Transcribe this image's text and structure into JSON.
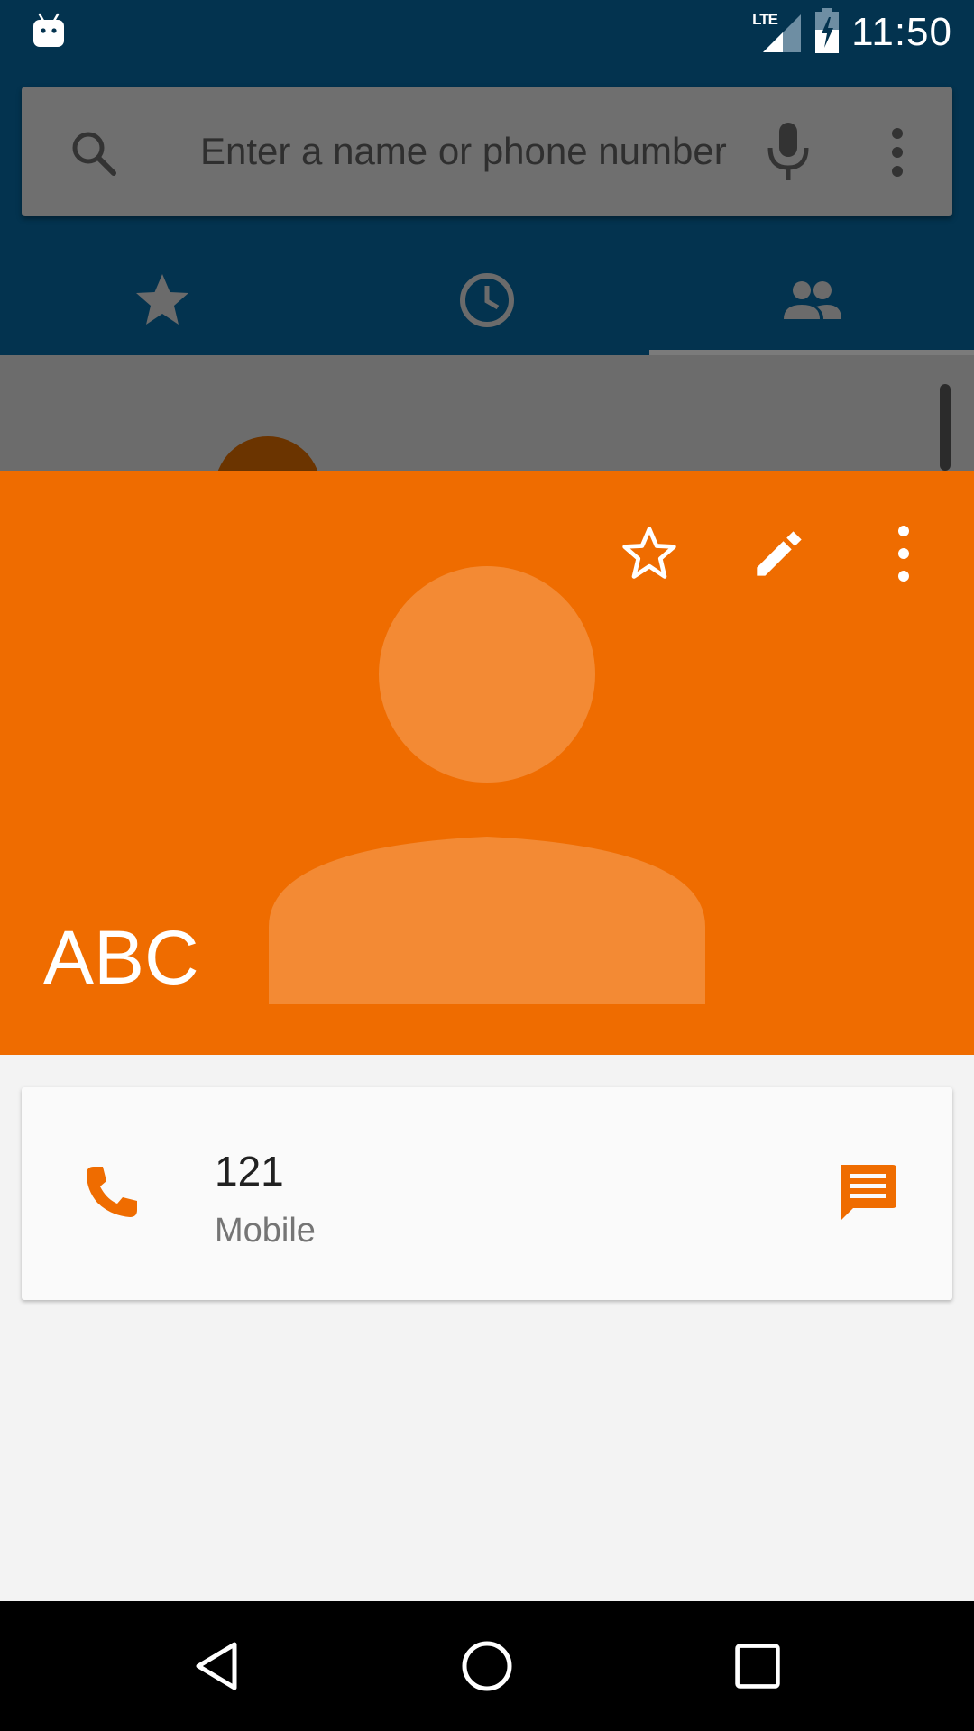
{
  "status_bar": {
    "time": "11:50",
    "network_label": "LTE",
    "icons": [
      "android-notification-icon",
      "lte-signal-icon",
      "battery-charging-icon"
    ]
  },
  "search": {
    "placeholder": "Enter a name or phone number"
  },
  "tabs": [
    {
      "name": "favorites",
      "icon": "star-icon",
      "selected": false
    },
    {
      "name": "recents",
      "icon": "clock-icon",
      "selected": false
    },
    {
      "name": "contacts",
      "icon": "people-icon",
      "selected": true
    }
  ],
  "contact": {
    "name": "ABC",
    "header_color": "#ef6c00",
    "actions": [
      "star-outline-icon",
      "edit-pencil-icon",
      "more-vert-icon"
    ],
    "phone": {
      "number": "121",
      "type": "Mobile"
    }
  },
  "colors": {
    "accent": "#ef6c00",
    "app_bar": "#03334f"
  }
}
